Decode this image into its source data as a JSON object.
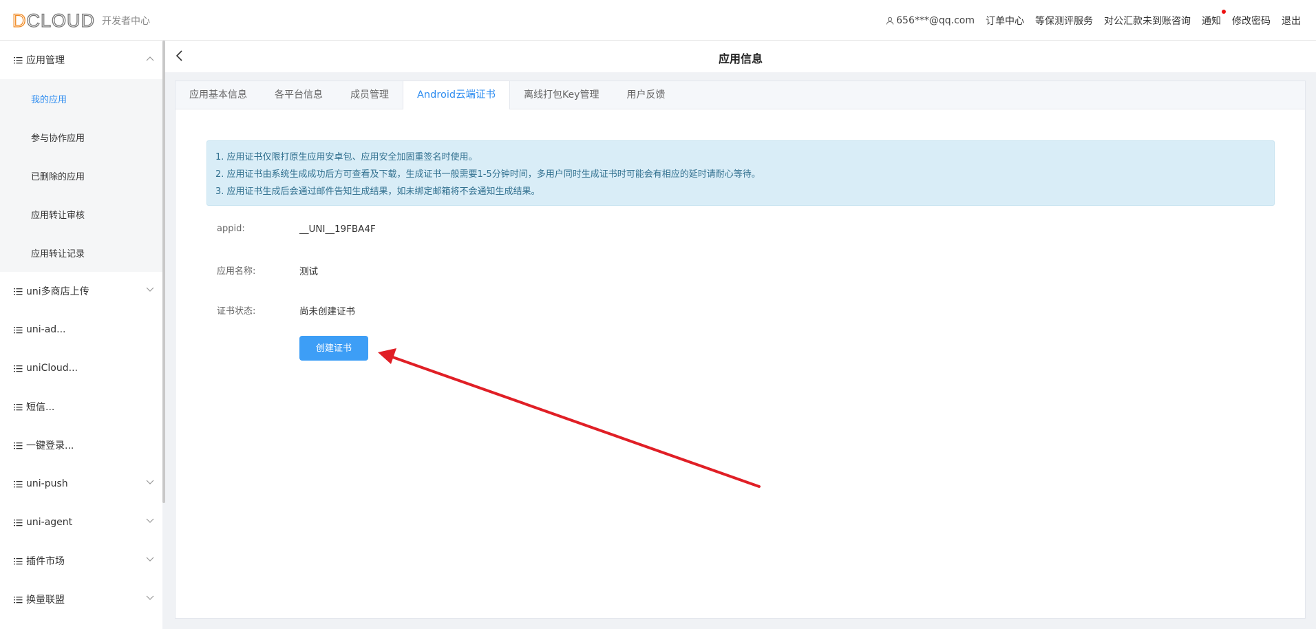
{
  "header": {
    "logo_text": "DCLOUD",
    "logo_subtitle": "开发者中心",
    "user_email": "656***@qq.com",
    "nav": [
      "订单中心",
      "等保测评服务",
      "对公汇款未到账咨询",
      "通知",
      "修改密码",
      "退出"
    ]
  },
  "sidebar": {
    "items": [
      {
        "label": "应用管理",
        "expanded": true
      },
      {
        "label": "uni多商店上传"
      },
      {
        "label": "uni-ad..."
      },
      {
        "label": "uniCloud..."
      },
      {
        "label": "短信..."
      },
      {
        "label": "一键登录..."
      },
      {
        "label": "uni-push"
      },
      {
        "label": "uni-agent"
      },
      {
        "label": "插件市场"
      },
      {
        "label": "换量联盟"
      }
    ],
    "sub_items": [
      "我的应用",
      "参与协作应用",
      "已删除的应用",
      "应用转让审核",
      "应用转让记录"
    ]
  },
  "page": {
    "title": "应用信息",
    "tabs": [
      "应用基本信息",
      "各平台信息",
      "成员管理",
      "Android云端证书",
      "离线打包Key管理",
      "用户反馈"
    ],
    "active_tab": "Android云端证书"
  },
  "notice": {
    "lines": [
      "1. 应用证书仅限打原生应用安卓包、应用安全加固重签名时使用。",
      "2. 应用证书由系统生成成功后方可查看及下载，生成证书一般需要1-5分钟时间，多用户同时生成证书时可能会有相应的延时请耐心等待。",
      "3. 应用证书生成后会通过邮件告知生成结果，如未绑定邮箱将不会通知生成结果。"
    ]
  },
  "details": {
    "appid_label": "appid:",
    "appid_value": "__UNI__19FBA4F",
    "name_label": "应用名称:",
    "name_value": "测试",
    "status_label": "证书状态:",
    "status_value": "尚未创建证书"
  },
  "actions": {
    "create_cert": "创建证书"
  },
  "colors": {
    "accent": "#2d8cf0",
    "button": "#3d9ef6",
    "notice_bg": "#d9edf7",
    "annotation_arrow": "#e01f26"
  }
}
